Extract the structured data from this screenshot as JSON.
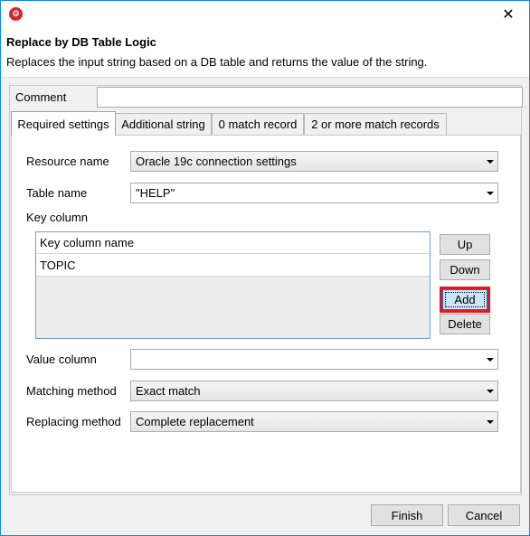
{
  "window": {
    "close_glyph": "✕"
  },
  "header": {
    "title": "Replace by DB Table Logic",
    "description": "Replaces the input string based on a DB table and returns the value of the string."
  },
  "comment": {
    "label": "Comment",
    "value": ""
  },
  "tabs": [
    {
      "label": "Required settings",
      "active": true
    },
    {
      "label": "Additional string",
      "active": false
    },
    {
      "label": "0 match record",
      "active": false
    },
    {
      "label": "2 or more match records",
      "active": false
    }
  ],
  "form": {
    "resource_name": {
      "label": "Resource name",
      "value": "Oracle 19c connection settings"
    },
    "table_name": {
      "label": "Table name",
      "value": "\"HELP\""
    },
    "key_column": {
      "label": "Key column",
      "header": "Key column name",
      "rows": [
        "TOPIC"
      ]
    },
    "value_column": {
      "label": "Value column",
      "value": ""
    },
    "matching_method": {
      "label": "Matching method",
      "value": "Exact match"
    },
    "replacing_method": {
      "label": "Replacing method",
      "value": "Complete replacement"
    }
  },
  "key_buttons": {
    "up": "Up",
    "down": "Down",
    "add": "Add",
    "delete": "Delete"
  },
  "footer": {
    "finish": "Finish",
    "cancel": "Cancel"
  },
  "colors": {
    "highlight": "#e8141e",
    "app_icon": "#d6232a",
    "window_border": "#1d87d9"
  }
}
